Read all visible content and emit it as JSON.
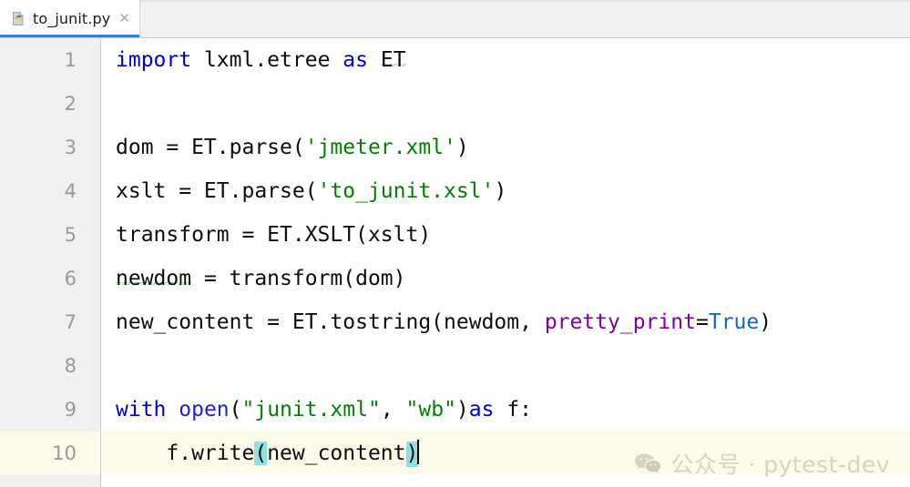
{
  "tab": {
    "filename": "to_junit.py",
    "icon": "python-file-icon",
    "close_label": "✕"
  },
  "editor": {
    "line_numbers": [
      "1",
      "2",
      "3",
      "4",
      "5",
      "6",
      "7",
      "8",
      "9",
      "10"
    ],
    "current_line": "10",
    "cursor_after": ")",
    "lines": [
      {
        "number": "1",
        "tokens": [
          {
            "text": "import",
            "kind": "keyword"
          },
          {
            "text": " lxml.etree ",
            "kind": "plain"
          },
          {
            "text": "as",
            "kind": "keyword"
          },
          {
            "text": " ",
            "kind": "plain"
          },
          {
            "text": "ET",
            "kind": "plain",
            "squiggle": "gray"
          }
        ]
      },
      {
        "number": "2",
        "tokens": []
      },
      {
        "number": "3",
        "tokens": [
          {
            "text": "dom = ET.parse(",
            "kind": "plain"
          },
          {
            "text": "'jmeter.xml'",
            "kind": "string"
          },
          {
            "text": ")",
            "kind": "plain"
          }
        ]
      },
      {
        "number": "4",
        "tokens": [
          {
            "text": "xslt = ET.parse(",
            "kind": "plain"
          },
          {
            "text": "'to_junit.xsl'",
            "kind": "string"
          },
          {
            "text": ")",
            "kind": "plain"
          }
        ]
      },
      {
        "number": "5",
        "tokens": [
          {
            "text": "transform = ET.XSLT(xslt)",
            "kind": "plain"
          }
        ]
      },
      {
        "number": "6",
        "tokens": [
          {
            "text": "newdom",
            "kind": "plain",
            "squiggle": "green"
          },
          {
            "text": " = transform(dom)",
            "kind": "plain"
          }
        ]
      },
      {
        "number": "7",
        "tokens": [
          {
            "text": "new_content = ET.tostring(newdom, ",
            "kind": "plain"
          },
          {
            "text": "pretty_print",
            "kind": "kwarg"
          },
          {
            "text": "=",
            "kind": "plain"
          },
          {
            "text": "True",
            "kind": "constant"
          },
          {
            "text": ")",
            "kind": "plain"
          }
        ]
      },
      {
        "number": "8",
        "tokens": []
      },
      {
        "number": "9",
        "tokens": [
          {
            "text": "with",
            "kind": "keyword"
          },
          {
            "text": " ",
            "kind": "plain"
          },
          {
            "text": "open",
            "kind": "builtin"
          },
          {
            "text": "(",
            "kind": "plain"
          },
          {
            "text": "\"junit.xml\"",
            "kind": "string"
          },
          {
            "text": ", ",
            "kind": "plain"
          },
          {
            "text": "\"wb\"",
            "kind": "string"
          },
          {
            "text": ")",
            "kind": "plain"
          },
          {
            "text": "as",
            "kind": "keyword"
          },
          {
            "text": " f:",
            "kind": "plain"
          }
        ]
      },
      {
        "number": "10",
        "current": true,
        "tokens": [
          {
            "text": "    f.write",
            "kind": "plain"
          },
          {
            "text": "(",
            "kind": "plain",
            "match": true
          },
          {
            "text": "new_content",
            "kind": "plain"
          },
          {
            "text": ")",
            "kind": "plain",
            "match": true,
            "squiggle": "gray"
          }
        ]
      }
    ]
  },
  "watermark": {
    "icon": "wechat-icon",
    "text": "公众号 · pytest-dev"
  },
  "colors": {
    "keyword": "#0000cc",
    "builtin": "#2222cc",
    "string": "#008000",
    "kwarg": "#8000a0",
    "constant": "#1565d8",
    "match_highlight": "#8fe0e0",
    "current_line": "#fcfae8",
    "gutter_bg": "#f0f0f0",
    "tab_accent": "#3c7fd0",
    "watermark": "#d8d4c4"
  }
}
